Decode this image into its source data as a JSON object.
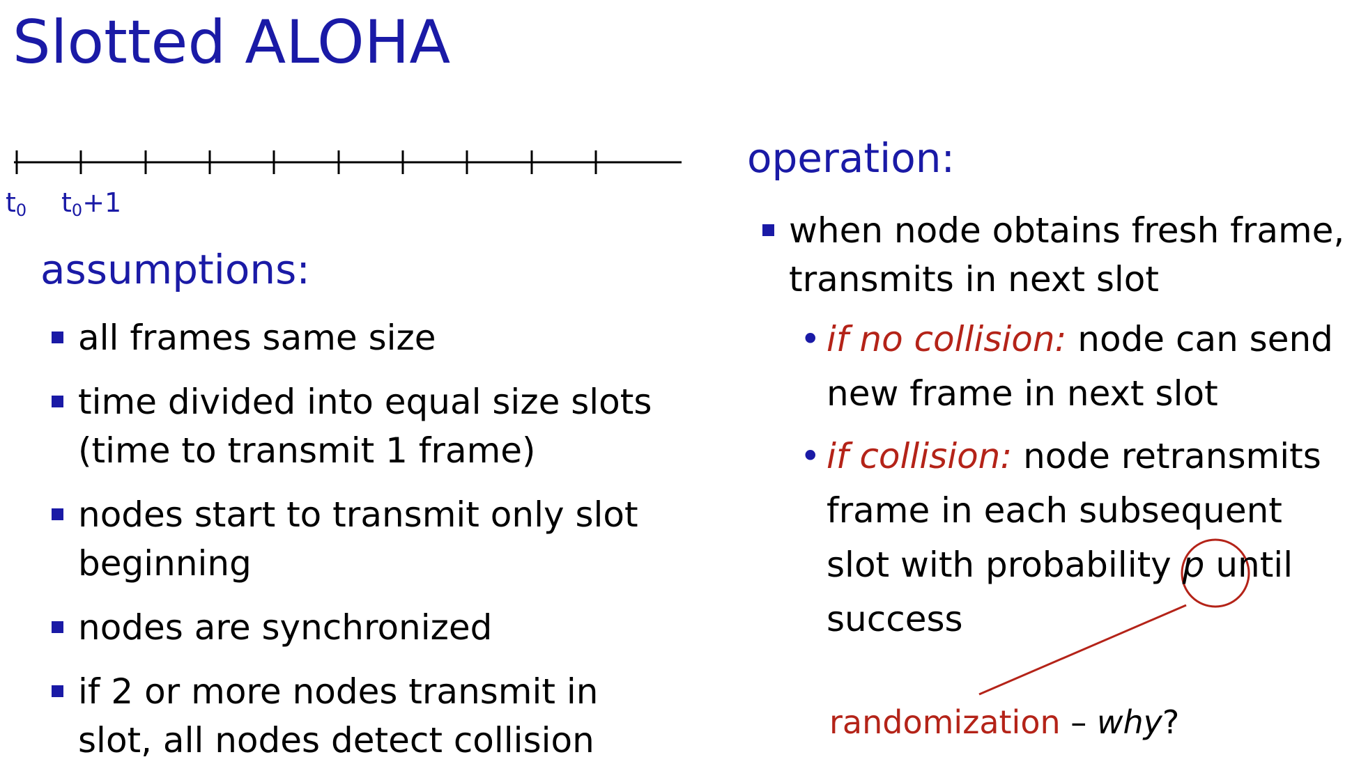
{
  "slide": {
    "title": "Slotted ALOHA"
  },
  "timeline": {
    "label_t0_base": "t",
    "label_t0_sub": "0",
    "label_t1_base": "t",
    "label_t1_sub": "0",
    "label_t1_suffix": "+1"
  },
  "assumptions": {
    "heading": "assumptions:",
    "items": [
      "all frames same size",
      "time divided into equal size slots (time to transmit 1 frame)",
      "nodes start to transmit only slot beginning",
      "nodes are synchronized",
      "if 2 or more nodes transmit in slot, all nodes detect collision"
    ]
  },
  "operation": {
    "heading": "operation:",
    "main_item": "when node obtains fresh frame, transmits in next slot",
    "sub_items": [
      {
        "label": "if no collision:",
        "text": " node can send new frame in next slot"
      },
      {
        "label": "if collision:",
        "text_before": " node retransmits frame in each subsequent slot with probability ",
        "variable": "p",
        "text_after": " until success"
      }
    ]
  },
  "callout": {
    "word": "randomization",
    "dash": " – ",
    "question": "why",
    "mark": "?"
  },
  "colors": {
    "title_blue": "#1a1aa6",
    "accent_red": "#b42318",
    "text": "#000000"
  },
  "icons": {
    "assumption_bullet": "square-bullet",
    "operation_bullet": "square-bullet",
    "sub_bullet": "round-bullet"
  }
}
